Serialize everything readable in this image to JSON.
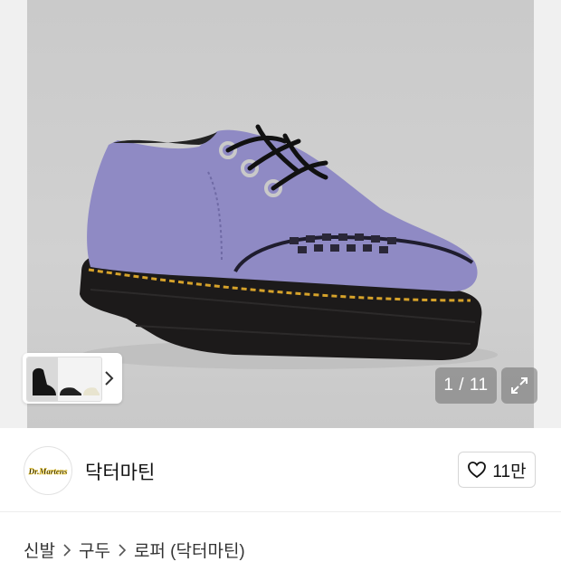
{
  "gallery": {
    "counter": "1 / 11",
    "product_color": "#8f8ac4",
    "thumbnails": [
      "boot-black",
      "shoe-black",
      "shoe-cream"
    ]
  },
  "brand": {
    "name": "닥터마틴",
    "logo_text": "Dr. Martens",
    "likes": "11만"
  },
  "breadcrumb": {
    "items": [
      "신발",
      "구두",
      "로퍼 (닥터마틴)"
    ]
  },
  "icons": {
    "thumb_next": "chevron-right-icon",
    "expand": "expand-icon",
    "like": "heart-outline-icon",
    "separator": "chevron-right-icon"
  }
}
